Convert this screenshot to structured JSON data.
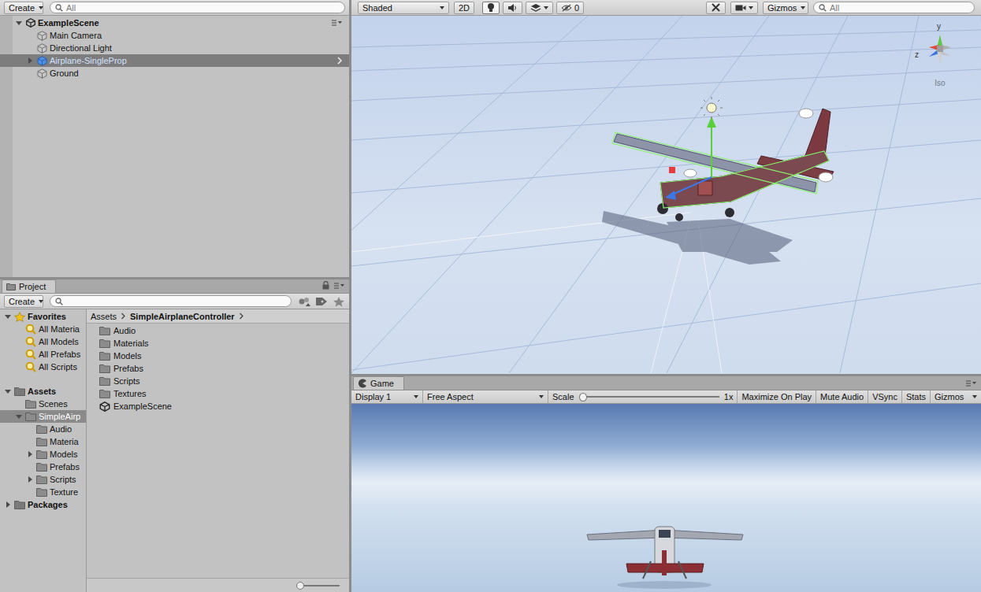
{
  "hierarchy": {
    "create_button": "Create",
    "search_placeholder": "All",
    "scene": {
      "label": "ExampleScene",
      "expanded": true
    },
    "items": [
      {
        "label": "Main Camera",
        "selected": false,
        "prefab": false,
        "expandable": false,
        "expanded": false
      },
      {
        "label": "Directional Light",
        "selected": false,
        "prefab": false,
        "expandable": false,
        "expanded": false
      },
      {
        "label": "Airplane-SingleProp",
        "selected": true,
        "prefab": true,
        "expandable": true,
        "expanded": false
      },
      {
        "label": "Ground",
        "selected": false,
        "prefab": false,
        "expandable": false,
        "expanded": false
      }
    ]
  },
  "project": {
    "tab": "Project",
    "create_button": "Create",
    "favorites": {
      "label": "Favorites",
      "expanded": true,
      "items": [
        "All Materia",
        "All Models",
        "All Prefabs",
        "All Scripts"
      ]
    },
    "tree": [
      {
        "label": "Assets",
        "kind": "root",
        "depth": 0,
        "expandable": true,
        "expanded": true,
        "selected": false
      },
      {
        "label": "Scenes",
        "kind": "folder",
        "depth": 1,
        "expandable": false,
        "expanded": false,
        "selected": false
      },
      {
        "label": "SimpleAirp",
        "kind": "folder",
        "depth": 1,
        "expandable": true,
        "expanded": true,
        "selected": true
      },
      {
        "label": "Audio",
        "kind": "folder",
        "depth": 2,
        "expandable": false,
        "expanded": false,
        "selected": false
      },
      {
        "label": "Materia",
        "kind": "folder",
        "depth": 2,
        "expandable": false,
        "expanded": false,
        "selected": false
      },
      {
        "label": "Models",
        "kind": "folder",
        "depth": 2,
        "expandable": true,
        "expanded": false,
        "selected": false
      },
      {
        "label": "Prefabs",
        "kind": "folder",
        "depth": 2,
        "expandable": false,
        "expanded": false,
        "selected": false
      },
      {
        "label": "Scripts",
        "kind": "folder",
        "depth": 2,
        "expandable": true,
        "expanded": false,
        "selected": false
      },
      {
        "label": "Texture",
        "kind": "folder",
        "depth": 2,
        "expandable": false,
        "expanded": false,
        "selected": false
      },
      {
        "label": "Packages",
        "kind": "root",
        "depth": 0,
        "expandable": true,
        "expanded": false,
        "selected": false
      }
    ],
    "breadcrumb": [
      "Assets",
      "SimpleAirplaneController"
    ],
    "files": [
      {
        "label": "Audio",
        "kind": "folder"
      },
      {
        "label": "Materials",
        "kind": "folder"
      },
      {
        "label": "Models",
        "kind": "folder"
      },
      {
        "label": "Prefabs",
        "kind": "folder"
      },
      {
        "label": "Scripts",
        "kind": "folder"
      },
      {
        "label": "Textures",
        "kind": "folder"
      },
      {
        "label": "ExampleScene",
        "kind": "scene"
      }
    ],
    "icon_size_level": 0
  },
  "scene_view": {
    "shading": "Shaded",
    "mode_2d": "2D",
    "lighting_on": true,
    "audio_on": false,
    "effects_on": false,
    "hidden_count": "0",
    "gizmos": "Gizmos",
    "search_placeholder": "All",
    "axes": [
      "y",
      "z"
    ],
    "view_label": "Iso"
  },
  "game_view": {
    "tab": "Game",
    "display": "Display 1",
    "aspect": "Free Aspect",
    "scale_label": "Scale",
    "scale_value": "1x",
    "scale_level": 0,
    "toggles": [
      {
        "label": "Maximize On Play",
        "on": false
      },
      {
        "label": "Mute Audio",
        "on": false
      },
      {
        "label": "VSync",
        "on": false
      },
      {
        "label": "Stats",
        "on": false
      }
    ],
    "gizmos": "Gizmos"
  }
}
